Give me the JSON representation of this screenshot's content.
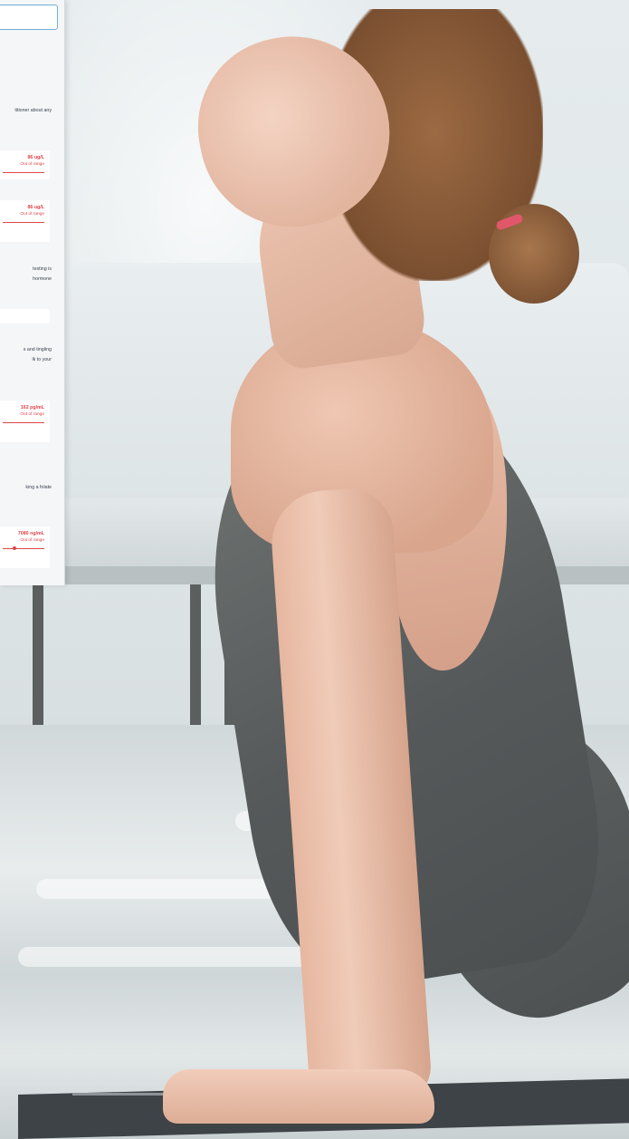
{
  "search": {
    "value": ""
  },
  "intro": {
    "line1": "titioner about any"
  },
  "results": [
    {
      "value": "86 ug/L",
      "status": "Out of range"
    },
    {
      "value": "86 ug/L",
      "status": "Out of range"
    },
    {
      "value": "162 pg/mL",
      "status": "Out of range"
    },
    {
      "value": "7080 ng/mL",
      "status": "Out of range"
    }
  ],
  "notes": {
    "testing": [
      "testing is",
      "hormone"
    ],
    "tingling": [
      "s and tingling",
      "lk to your"
    ],
    "folate": [
      "king a folate"
    ]
  },
  "colors": {
    "out_of_range": "#e0454b",
    "panel_bg": "#f4f6f8",
    "search_border": "#6fb0d6"
  },
  "icons": []
}
